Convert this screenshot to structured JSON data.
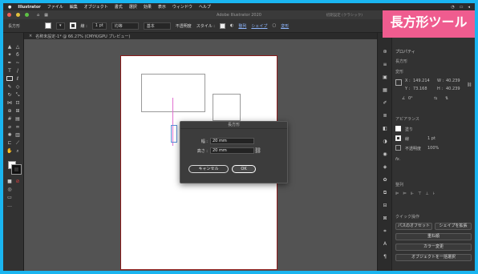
{
  "menu": {
    "apple": "",
    "app": "Illustrator",
    "items": [
      "ファイル",
      "編集",
      "オブジェクト",
      "書式",
      "選択",
      "効果",
      "表示",
      "ウィンドウ",
      "ヘルプ"
    ]
  },
  "window": {
    "title": "Adobe Illustrator 2020",
    "workspace": "初期設定 (クラシック)"
  },
  "control": {
    "label": "長方形",
    "stroke_label": "線 :",
    "stroke_value": "1 pt",
    "profile": "均等",
    "brush": "基本",
    "opacity_label": "不透明度",
    "style_label": "スタイル :",
    "align": "整列",
    "shape": "シェイプ",
    "transform": "変形"
  },
  "doc_tab": {
    "name": "名称未設定-1* @ 66.27% (CMYK/GPU プレビュー)"
  },
  "dialog": {
    "title": "長方形",
    "width_label": "幅 :",
    "width_value": "20 mm",
    "height_label": "高さ :",
    "height_value": "20 mm",
    "cancel": "キャンセル",
    "ok": "OK"
  },
  "banner": {
    "text": "長方形ツール"
  },
  "properties": {
    "tab": "プロパティ",
    "section_shape": "長方形",
    "section_transform": "変形",
    "x_label": "X :",
    "x_value": "149.214",
    "y_label": "Y :",
    "y_value": "73.168",
    "w_label": "W :",
    "w_value": "40.239",
    "h_label": "H :",
    "h_value": "40.239",
    "angle": "0°",
    "appearance": "アピアランス",
    "fill": "塗り",
    "stroke": "線",
    "stroke_value": "1 pt",
    "opacity": "不透明度",
    "opacity_value": "100%",
    "fx": "fx.",
    "align": "整列",
    "quick_actions": "クイック操作",
    "path_offset": "パスのオフセット",
    "expand_shape": "シェイプを拡張",
    "arrange": "重ね順",
    "recolor": "カラー変更",
    "global_edit": "オブジェクトを一括選択"
  },
  "colors": {
    "accent": "#1ab5f0",
    "banner": "#ef5c8f",
    "artboard_border": "#8b1a1a"
  }
}
